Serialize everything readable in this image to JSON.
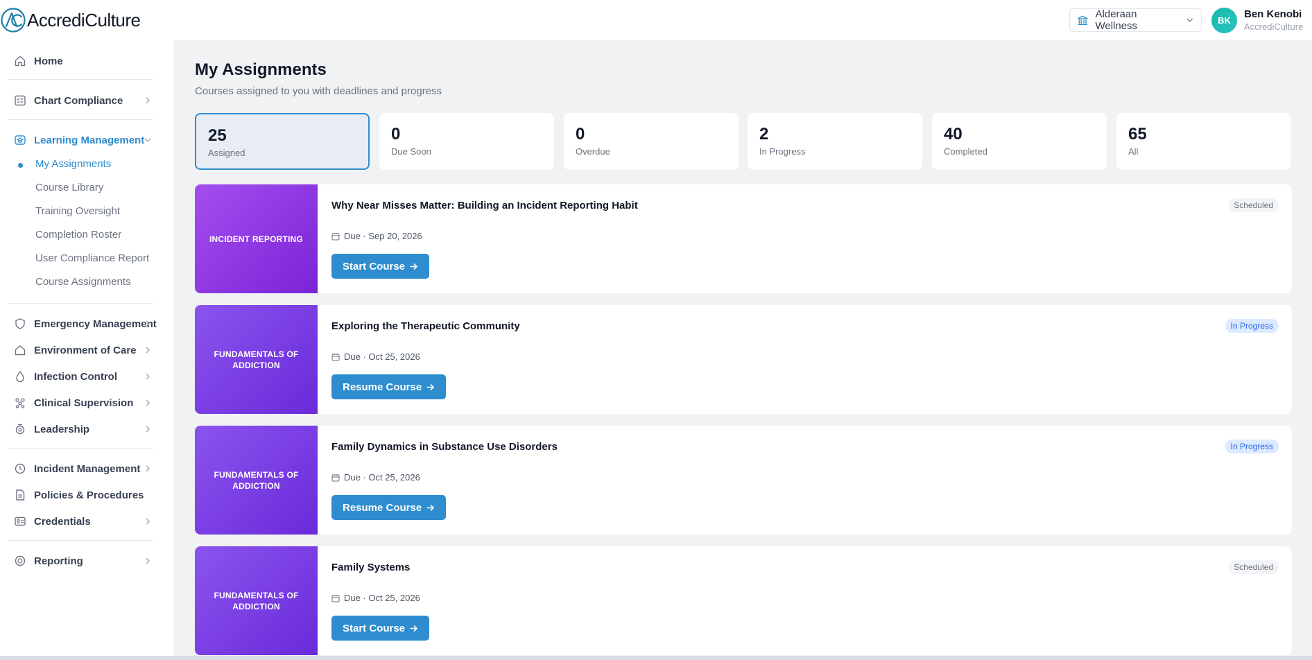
{
  "app": {
    "name": "AccrediCulture"
  },
  "header": {
    "org_selector": "Alderaan Wellness",
    "user": {
      "initials": "BK",
      "name": "Ben Kenobi",
      "org": "AccrediCulture"
    }
  },
  "sidebar": {
    "home": "Home",
    "chart_compliance": "Chart Compliance",
    "learning_management": "Learning Management",
    "learning_sub": [
      "My Assignments",
      "Course Library",
      "Training Oversight",
      "Completion Roster",
      "User Compliance Report",
      "Course Assignments"
    ],
    "emergency_management": "Emergency Management",
    "environment_of_care": "Environment of Care",
    "infection_control": "Infection Control",
    "clinical_supervision": "Clinical Supervision",
    "leadership": "Leadership",
    "incident_management": "Incident Management",
    "policies_procedures": "Policies & Procedures",
    "credentials": "Credentials",
    "reporting": "Reporting"
  },
  "main": {
    "title": "My Assignments",
    "subtitle": "Courses assigned to you with deadlines and progress"
  },
  "stats": [
    {
      "value": "25",
      "label": "Assigned"
    },
    {
      "value": "0",
      "label": "Due Soon"
    },
    {
      "value": "0",
      "label": "Overdue"
    },
    {
      "value": "2",
      "label": "In Progress"
    },
    {
      "value": "40",
      "label": "Completed"
    },
    {
      "value": "65",
      "label": "All"
    }
  ],
  "courses": [
    {
      "category": "INCIDENT REPORTING",
      "title": "Why Near Misses Matter: Building an Incident Reporting Habit",
      "due": "Due · Sep 20, 2026",
      "action": "Start Course",
      "status": "Scheduled"
    },
    {
      "category": "FUNDAMENTALS OF ADDICTION",
      "title": "Exploring the Therapeutic Community",
      "due": "Due · Oct 25, 2026",
      "action": "Resume Course",
      "status": "In Progress"
    },
    {
      "category": "FUNDAMENTALS OF ADDICTION",
      "title": "Family Dynamics in Substance Use Disorders",
      "due": "Due · Oct 25, 2026",
      "action": "Resume Course",
      "status": "In Progress"
    },
    {
      "category": "FUNDAMENTALS OF ADDICTION",
      "title": "Family Systems",
      "due": "Due · Oct 25, 2026",
      "action": "Start Course",
      "status": "Scheduled"
    }
  ],
  "colors": {
    "accent": "#2d8dcf",
    "brand_teal": "#1e9bb8",
    "card_purple": "#9b4cec",
    "card_violet": "#7c3aed"
  }
}
